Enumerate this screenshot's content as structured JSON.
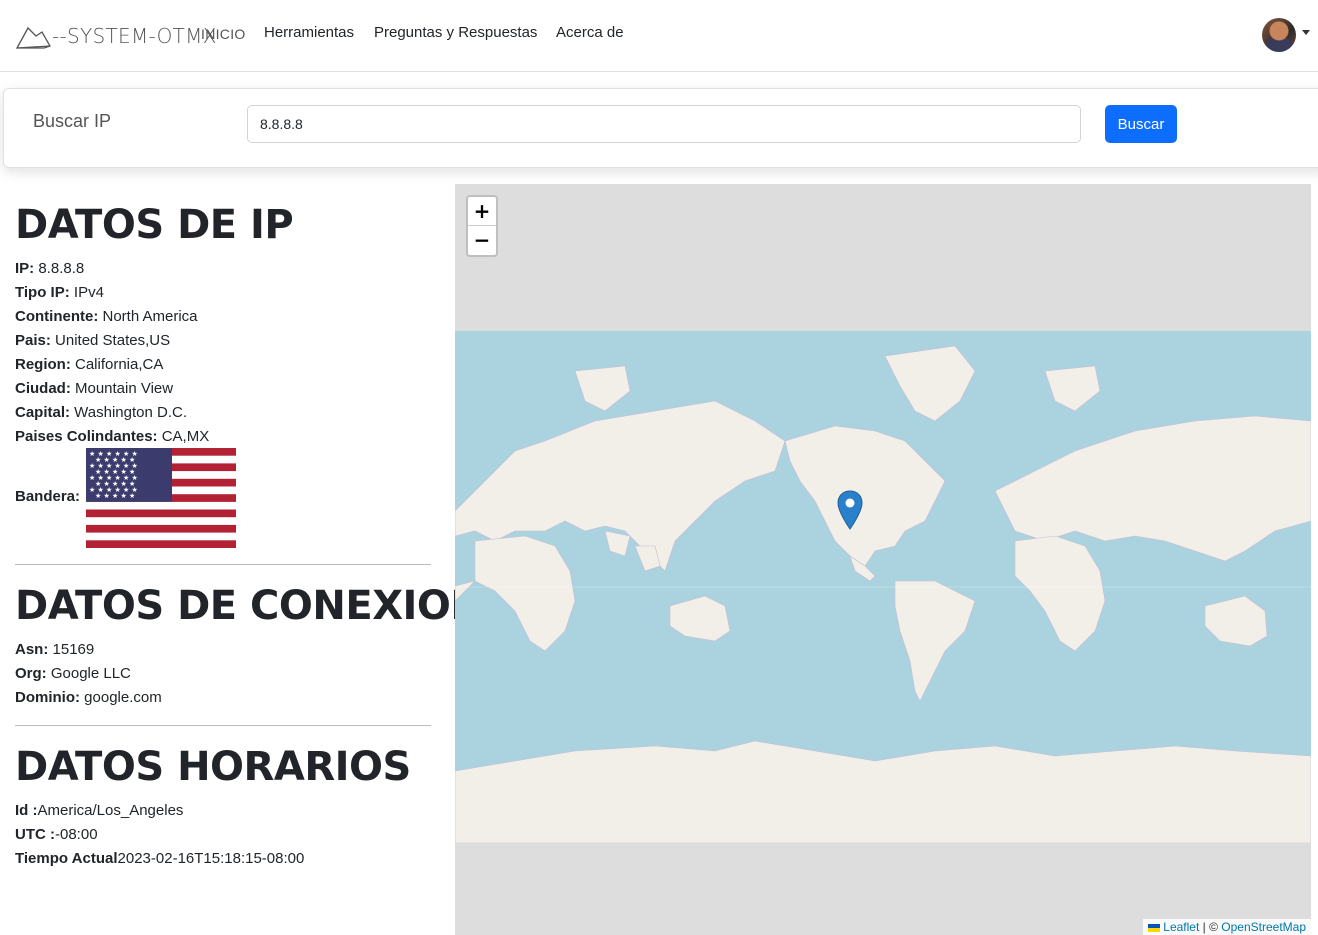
{
  "navbar": {
    "brand": "--SYSTEM-OTMX",
    "links": [
      "INICIO",
      "Herramientas",
      "Preguntas y Respuestas",
      "Acerca de"
    ]
  },
  "search": {
    "label": "Buscar IP",
    "value": "8.8.8.8",
    "button": "Buscar"
  },
  "ip": {
    "title": "DATOS DE IP",
    "rows": [
      {
        "label": "IP:",
        "value": " 8.8.8.8"
      },
      {
        "label": "Tipo IP:",
        "value": " IPv4"
      },
      {
        "label": "Continente:",
        "value": " North America"
      },
      {
        "label": "Pais:",
        "value": " United States,US"
      },
      {
        "label": "Region:",
        "value": " California,CA"
      },
      {
        "label": "Ciudad:",
        "value": " Mountain View"
      },
      {
        "label": "Capital:",
        "value": " Washington D.C."
      },
      {
        "label": "Paises Colindantes:",
        "value": " CA,MX"
      }
    ],
    "flag_label": "Bandera:"
  },
  "connection": {
    "title": "DATOS DE CONEXION",
    "rows": [
      {
        "label": "Asn:",
        "value": " 15169"
      },
      {
        "label": "Org:",
        "value": " Google LLC"
      },
      {
        "label": "Dominio:",
        "value": " google.com"
      }
    ]
  },
  "time": {
    "title": "DATOS HORARIOS",
    "rows": [
      {
        "label": "Id :",
        "value": "America/Los_Angeles"
      },
      {
        "label": "UTC :",
        "value": "-08:00"
      },
      {
        "label": "Tiempo Actual",
        "value": "2023-02-16T15:18:15-08:00"
      }
    ]
  },
  "map": {
    "zoom_in": "+",
    "zoom_out": "−",
    "attribution_leaflet": "Leaflet",
    "attribution_sep": " | © ",
    "attribution_osm": "OpenStreetMap"
  },
  "icons": {
    "brand": "cloud-outline-icon",
    "marker": "map-pin-icon",
    "caret": "caret-down-icon"
  },
  "colors": {
    "primary": "#0d6efd",
    "ocean": "#aad3df",
    "land": "#f2efe9",
    "marker": "#2a81cb"
  }
}
